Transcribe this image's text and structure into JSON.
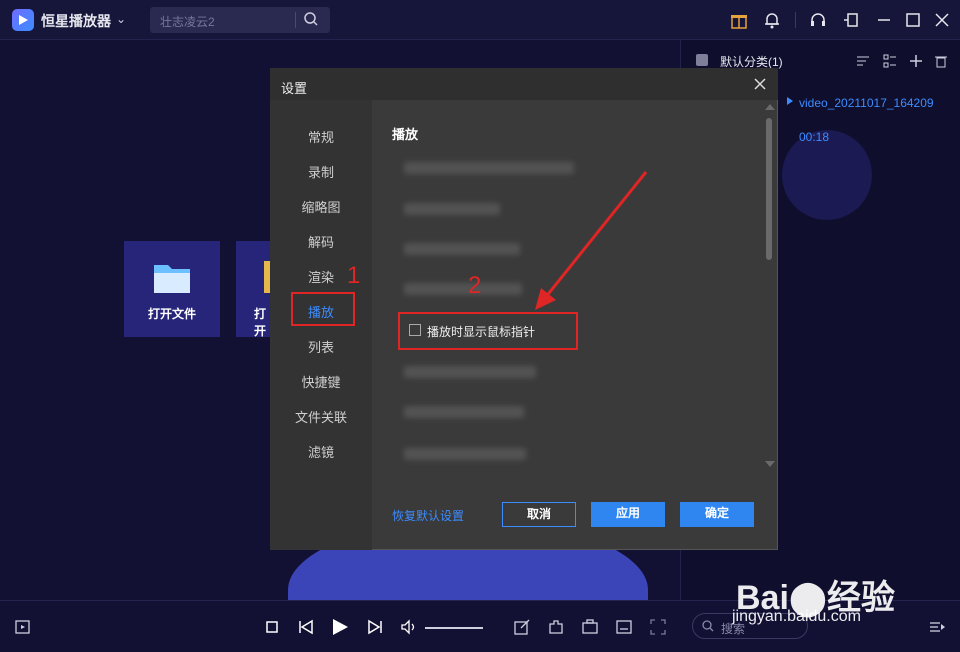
{
  "app": {
    "title": "恒星播放器",
    "chevron": "⌄"
  },
  "topsearch": {
    "placeholder": "壮志凌云2"
  },
  "tiles": {
    "open_file": "打开文件",
    "open_other": "打开"
  },
  "playlist": {
    "title": "默认分类(1)",
    "video_name": "video_20211017_164209",
    "duration": "00:18",
    "search_placeholder": "搜索"
  },
  "dialog": {
    "title": "设置",
    "nav": [
      "常规",
      "录制",
      "缩略图",
      "解码",
      "渲染",
      "播放",
      "列表",
      "快捷键",
      "文件关联",
      "滤镜"
    ],
    "active_index": 5,
    "section_title": "播放",
    "checkbox_label": "播放时显示鼠标指针",
    "restore_label": "恢复默认设置",
    "cancel_label": "取消",
    "apply_label": "应用",
    "ok_label": "确定"
  },
  "annotations": {
    "one": "1",
    "two": "2"
  },
  "watermark": {
    "logo": "Bai⬤经验",
    "url": "jingyan.baidu.com"
  },
  "colors": {
    "accent": "#3c8cff",
    "annotation": "#e02525",
    "background": "#15143a"
  }
}
